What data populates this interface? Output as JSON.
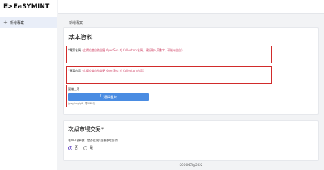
{
  "app": {
    "logo_mark": "E>",
    "logo_text": "EaSYMINT"
  },
  "sidebar": {
    "items": [
      {
        "icon": "plus-icon",
        "label": "新增專案"
      }
    ]
  },
  "page": {
    "title": "新增專案"
  },
  "basic_info": {
    "title": "基本資料",
    "name_field": {
      "label": "*專案名稱",
      "hint": "（此欄位會自動變更 OpenSea 的 Collection 名稱，建議輸入英數字，不能有空白）"
    },
    "content_field": {
      "label": "*專案內容",
      "hint": "（此欄位會自動變更 OpenSea 的 Collection 內容）"
    },
    "image_upload": {
      "label": "圖檔上傳",
      "button_label": "選擇圖片",
      "hint": "jpeg/png/gif，限5MB內"
    }
  },
  "market": {
    "title": "次級市場交易",
    "required_mark": "*",
    "question": "若NFT被轉賣，是否從成交金額收取分潤",
    "options": [
      "否",
      "是"
    ],
    "selected": "否"
  },
  "footer": {
    "text": "SOOCKER@2022"
  }
}
